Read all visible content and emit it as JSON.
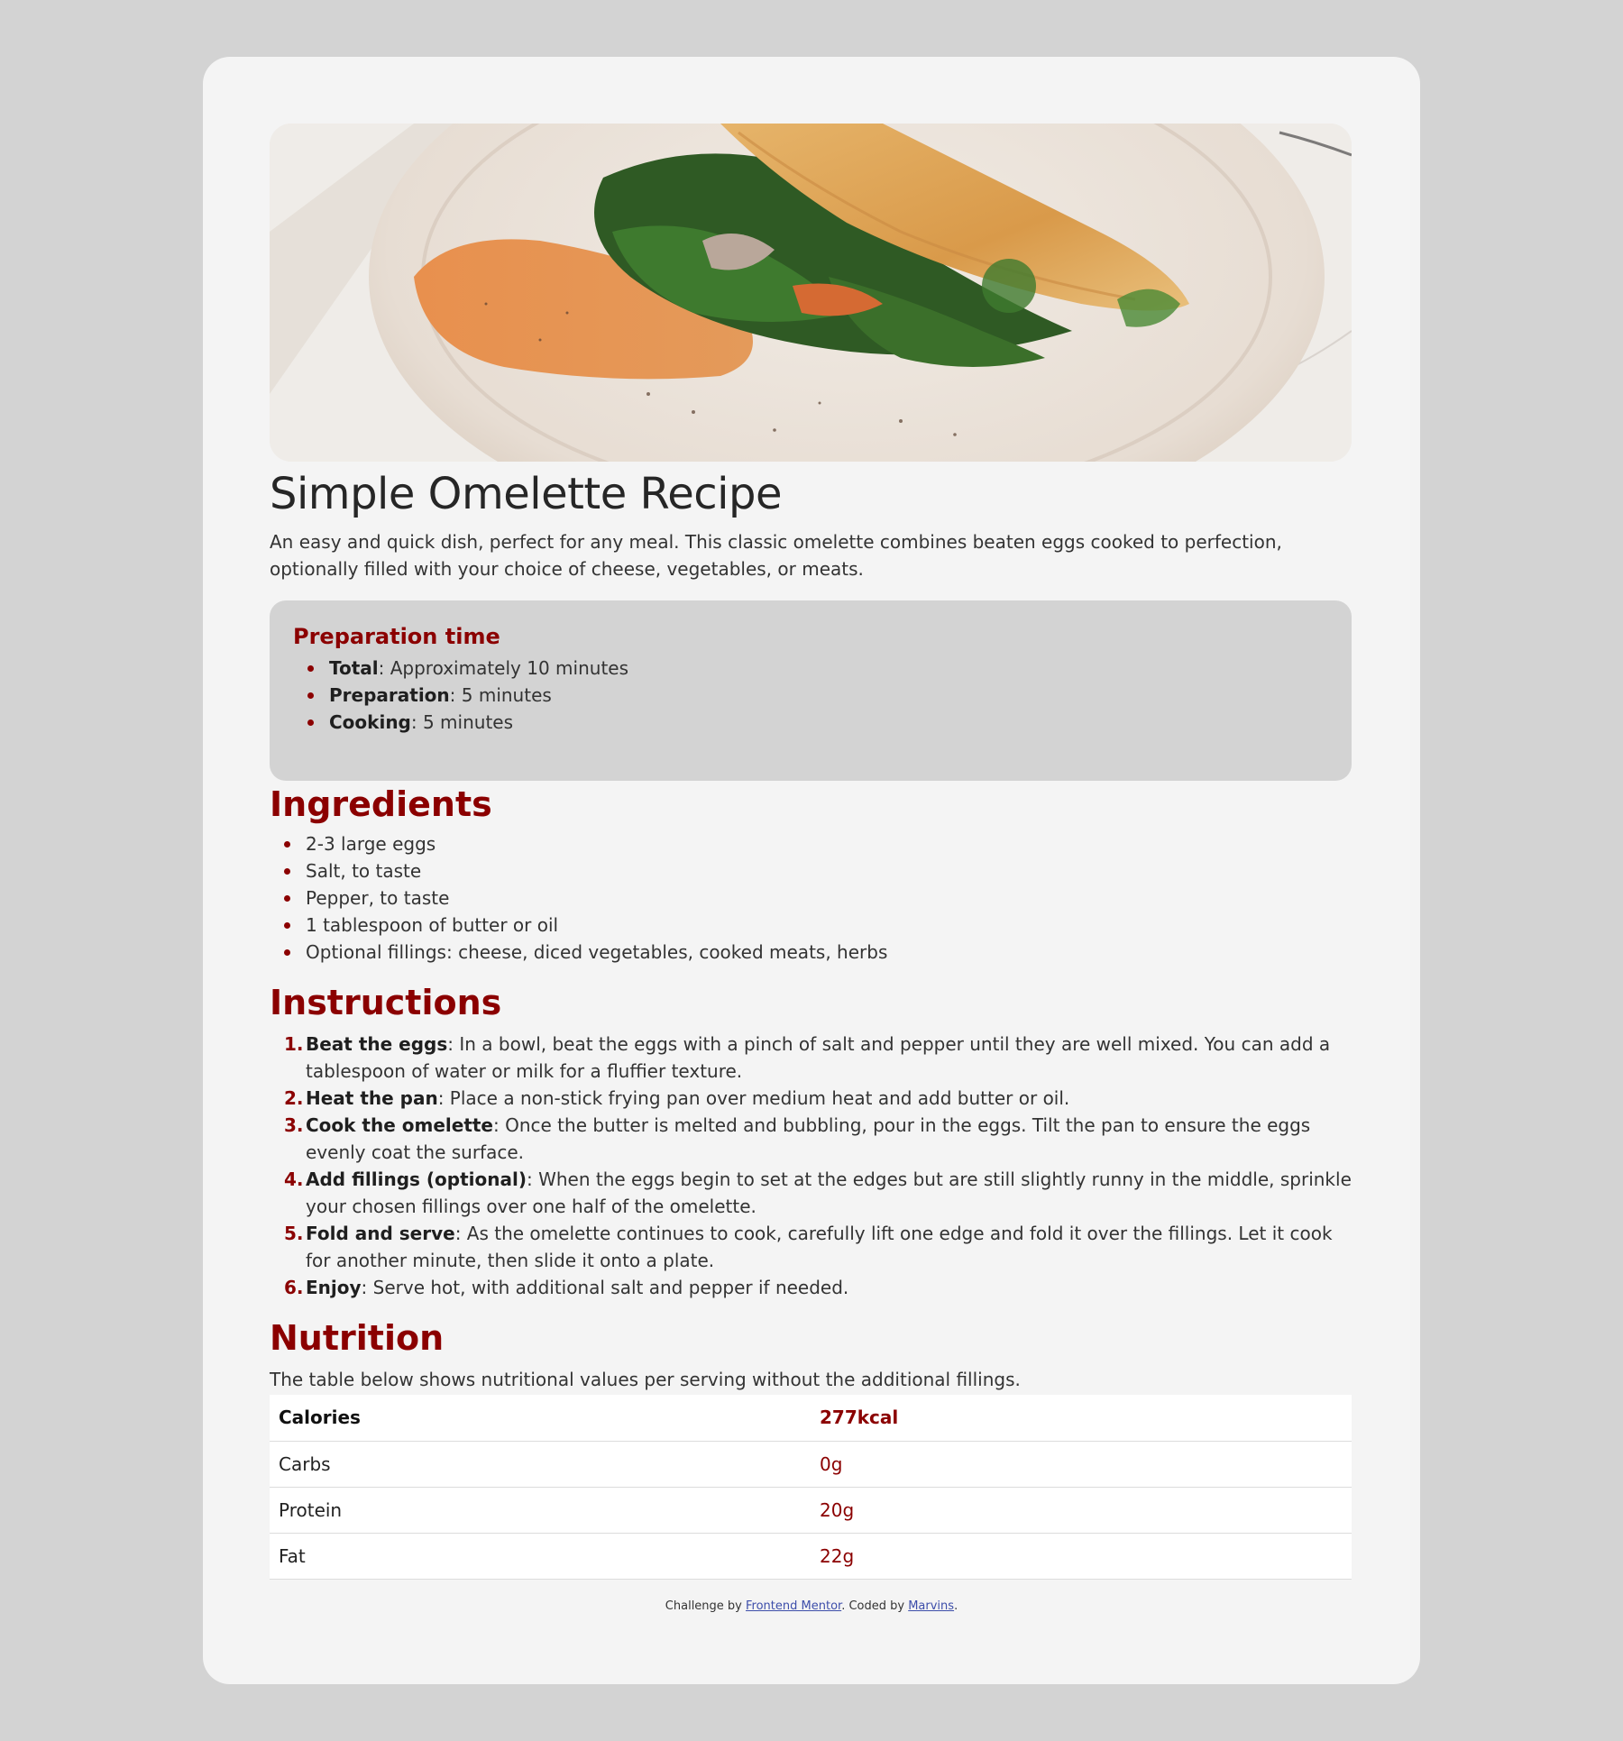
{
  "recipe": {
    "title": "Simple Omelette Recipe",
    "description": "An easy and quick dish, perfect for any meal. This classic omelette combines beaten eggs cooked to perfection, optionally filled with your choice of cheese, vegetables, or meats."
  },
  "preparation": {
    "heading": "Preparation time",
    "items": [
      {
        "label": "Total",
        "value": ": Approximately 10 minutes"
      },
      {
        "label": "Preparation",
        "value": ": 5 minutes"
      },
      {
        "label": "Cooking",
        "value": ": 5 minutes"
      }
    ]
  },
  "ingredients": {
    "heading": "Ingredients",
    "items": [
      "2-3 large eggs",
      "Salt, to taste",
      "Pepper, to taste",
      "1 tablespoon of butter or oil",
      "Optional fillings: cheese, diced vegetables, cooked meats, herbs"
    ]
  },
  "instructions": {
    "heading": "Instructions",
    "steps": [
      {
        "num": "1.",
        "label": "Beat the eggs",
        "text": ": In a bowl, beat the eggs with a pinch of salt and pepper until they are well mixed. You can add a tablespoon of water or milk for a fluffier texture."
      },
      {
        "num": "2.",
        "label": "Heat the pan",
        "text": ": Place a non-stick frying pan over medium heat and add butter or oil."
      },
      {
        "num": "3.",
        "label": "Cook the omelette",
        "text": ": Once the butter is melted and bubbling, pour in the eggs. Tilt the pan to ensure the eggs evenly coat the surface."
      },
      {
        "num": "4.",
        "label": "Add fillings (optional)",
        "text": ": When the eggs begin to set at the edges but are still slightly runny in the middle, sprinkle your chosen fillings over one half of the omelette."
      },
      {
        "num": "5.",
        "label": "Fold and serve",
        "text": ": As the omelette continues to cook, carefully lift one edge and fold it over the fillings. Let it cook for another minute, then slide it onto a plate."
      },
      {
        "num": "6.",
        "label": "Enjoy",
        "text": ": Serve hot, with additional salt and pepper if needed."
      }
    ]
  },
  "nutrition": {
    "heading": "Nutrition",
    "description": "The table below shows nutritional values per serving without the additional fillings.",
    "rows": [
      {
        "name": "Calories",
        "value": "277kcal"
      },
      {
        "name": "Carbs",
        "value": "0g"
      },
      {
        "name": "Protein",
        "value": "20g"
      },
      {
        "name": "Fat",
        "value": "22g"
      }
    ]
  },
  "footer": {
    "prefix": "Challenge by ",
    "challenge_link": "Frontend Mentor",
    "middle": ". Coded by ",
    "author_link": "Marvins",
    "suffix": "."
  },
  "colors": {
    "accent": "#8b0000",
    "page_bg": "#d3d3d3",
    "card_bg": "#f4f4f4",
    "link": "#3d4eaa"
  }
}
